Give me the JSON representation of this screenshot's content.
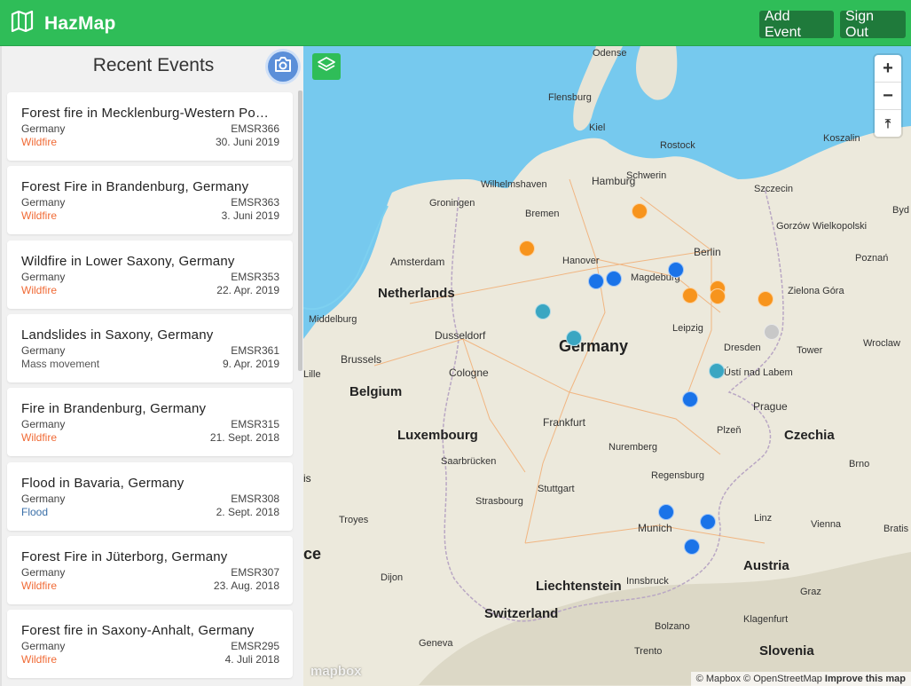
{
  "app": {
    "title": "HazMap",
    "add_event": "Add Event",
    "sign_out": "Sign Out"
  },
  "sidebar": {
    "title": "Recent Events",
    "events": [
      {
        "title": "Forest fire in Mecklenburg-Western Po…",
        "country": "Germany",
        "id": "EMSR366",
        "type": "Wildfire",
        "date": "30. Juni 2019"
      },
      {
        "title": "Forest Fire in Brandenburg, Germany",
        "country": "Germany",
        "id": "EMSR363",
        "type": "Wildfire",
        "date": "3. Juni 2019"
      },
      {
        "title": "Wildfire in Lower Saxony, Germany",
        "country": "Germany",
        "id": "EMSR353",
        "type": "Wildfire",
        "date": "22. Apr. 2019"
      },
      {
        "title": "Landslides in Saxony, Germany",
        "country": "Germany",
        "id": "EMSR361",
        "type": "Mass movement",
        "date": "9. Apr. 2019"
      },
      {
        "title": "Fire in Brandenburg, Germany",
        "country": "Germany",
        "id": "EMSR315",
        "type": "Wildfire",
        "date": "21. Sept. 2018"
      },
      {
        "title": "Flood in Bavaria, Germany",
        "country": "Germany",
        "id": "EMSR308",
        "type": "Flood",
        "date": "2. Sept. 2018"
      },
      {
        "title": "Forest Fire in Jüterborg, Germany",
        "country": "Germany",
        "id": "EMSR307",
        "type": "Wildfire",
        "date": "23. Aug. 2018"
      },
      {
        "title": "Forest fire in Saxony-Anhalt, Germany",
        "country": "Germany",
        "id": "EMSR295",
        "type": "Wildfire",
        "date": "4. Juli 2018"
      }
    ]
  },
  "colors": {
    "wildfire": "#f06a35",
    "mass_movement": "#555555",
    "flood": "#3a6fa8",
    "brand": "#2fbd58",
    "marker_orange": "#f7941d",
    "marker_blue": "#1a73e8",
    "marker_teal": "#3aa6c2",
    "marker_gray": "#c8c8c8"
  },
  "map": {
    "labels": {
      "netherlands": "Netherlands",
      "belgium": "Belgium",
      "luxembourg": "Luxembourg",
      "germany": "Germany",
      "czechia": "Czechia",
      "austria": "Austria",
      "switzerland": "Switzerland",
      "liechtenstein": "Liechtenstein",
      "slovenia": "Slovenia",
      "france_partial": "ce",
      "odense": "Odense",
      "flensburg": "Flensburg",
      "kiel": "Kiel",
      "rostock": "Rostock",
      "koszalin": "Koszalin",
      "wilhelmshaven": "Wilhelmshaven",
      "hamburg": "Hamburg",
      "schwerin": "Schwerin",
      "szczecin": "Szczecin",
      "groningen": "Groningen",
      "bremen": "Bremen",
      "gorzow": "Gorzów\nWielkopolski",
      "bydg": "Byd",
      "amsterdam": "Amsterdam",
      "hanover": "Hanover",
      "berlin": "Berlin",
      "poznan": "Poznań",
      "magdeburg": "Magdeburg",
      "zielona": "Zielona Góra",
      "middelburg": "Middelburg",
      "dusseldorf": "Dusseldorf",
      "leipzig": "Leipzig",
      "dresden": "Dresden",
      "wroclaw": "Wroclaw",
      "brussels": "Brussels",
      "cologne": "Cologne",
      "tower": "Tower",
      "lille": "Lille",
      "ustinad": "Ústí nad Labem",
      "prague": "Prague",
      "frankfurt": "Frankfurt",
      "plzen": "Plzeň",
      "nuremberg": "Nuremberg",
      "saarbrucken": "Saarbrücken",
      "brno": "Brno",
      "regensburg": "Regensburg",
      "stuttgart": "Stuttgart",
      "strasbourg": "Strasbourg",
      "linz": "Linz",
      "vienna": "Vienna",
      "troyes": "Troyes",
      "munich": "Munich",
      "bratis": "Bratis",
      "dijon": "Dijon",
      "innsbruck": "Innsbruck",
      "graz": "Graz",
      "klagenfurt": "Klagenfurt",
      "geneva": "Geneva",
      "bolzano": "Bolzano",
      "trento": "Trento",
      "paris_partial": "is"
    },
    "zoom_in": "+",
    "zoom_out": "−",
    "compass": "⤒",
    "attribution": {
      "mapbox": "© Mapbox",
      "osm": "© OpenStreetMap",
      "improve": "Improve this map"
    },
    "logo": "mapbox",
    "markers": [
      {
        "type": "orange",
        "id": "m1"
      },
      {
        "type": "orange",
        "id": "m2"
      },
      {
        "type": "blue",
        "id": "m3"
      },
      {
        "type": "blue",
        "id": "m4"
      },
      {
        "type": "blue",
        "id": "m5"
      },
      {
        "type": "orange",
        "id": "m6"
      },
      {
        "type": "orange",
        "id": "m7"
      },
      {
        "type": "orange",
        "id": "m8"
      },
      {
        "type": "orange",
        "id": "m9"
      },
      {
        "type": "teal",
        "id": "m10"
      },
      {
        "type": "teal",
        "id": "m11"
      },
      {
        "type": "gray",
        "id": "m12"
      },
      {
        "type": "teal",
        "id": "m13"
      },
      {
        "type": "blue",
        "id": "m14"
      },
      {
        "type": "blue",
        "id": "m15"
      },
      {
        "type": "blue",
        "id": "m16"
      },
      {
        "type": "blue",
        "id": "m17"
      }
    ]
  }
}
